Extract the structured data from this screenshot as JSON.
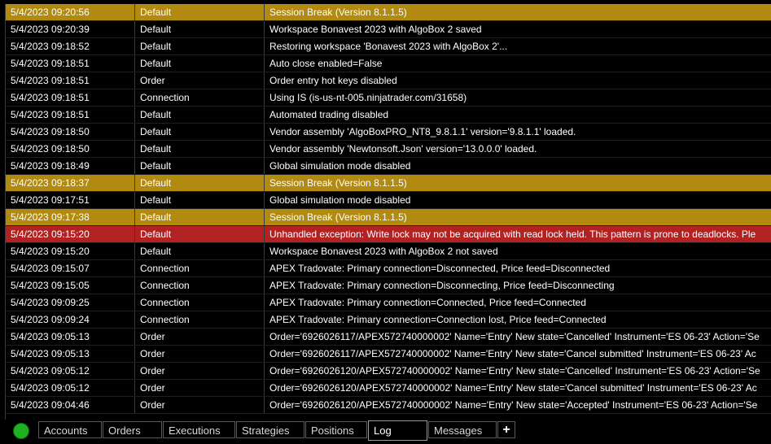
{
  "log": {
    "rows": [
      {
        "time": "5/4/2023 09:20:56",
        "category": "Default",
        "message": "Session Break (Version 8.1.1.5)",
        "kind": "session-break"
      },
      {
        "time": "5/4/2023 09:20:39",
        "category": "Default",
        "message": "Workspace Bonavest 2023 with AlgoBox 2 saved",
        "kind": "normal"
      },
      {
        "time": "5/4/2023 09:18:52",
        "category": "Default",
        "message": "Restoring workspace 'Bonavest 2023 with AlgoBox 2'...",
        "kind": "normal"
      },
      {
        "time": "5/4/2023 09:18:51",
        "category": "Default",
        "message": "Auto close enabled=False",
        "kind": "normal"
      },
      {
        "time": "5/4/2023 09:18:51",
        "category": "Order",
        "message": "Order entry hot keys disabled",
        "kind": "normal"
      },
      {
        "time": "5/4/2023 09:18:51",
        "category": "Connection",
        "message": "Using IS (is-us-nt-005.ninjatrader.com/31658)",
        "kind": "normal"
      },
      {
        "time": "5/4/2023 09:18:51",
        "category": "Default",
        "message": "Automated trading disabled",
        "kind": "normal"
      },
      {
        "time": "5/4/2023 09:18:50",
        "category": "Default",
        "message": "Vendor assembly 'AlgoBoxPRO_NT8_9.8.1.1' version='9.8.1.1' loaded.",
        "kind": "normal"
      },
      {
        "time": "5/4/2023 09:18:50",
        "category": "Default",
        "message": "Vendor assembly 'Newtonsoft.Json' version='13.0.0.0' loaded.",
        "kind": "normal"
      },
      {
        "time": "5/4/2023 09:18:49",
        "category": "Default",
        "message": "Global simulation mode disabled",
        "kind": "normal"
      },
      {
        "time": "5/4/2023 09:18:37",
        "category": "Default",
        "message": "Session Break (Version 8.1.1.5)",
        "kind": "session-break"
      },
      {
        "time": "5/4/2023 09:17:51",
        "category": "Default",
        "message": "Global simulation mode disabled",
        "kind": "normal"
      },
      {
        "time": "5/4/2023 09:17:38",
        "category": "Default",
        "message": "Session Break (Version 8.1.1.5)",
        "kind": "session-break"
      },
      {
        "time": "5/4/2023 09:15:20",
        "category": "Default",
        "message": "Unhandled exception: Write lock may not be acquired with read lock held. This pattern is prone to deadlocks. Ple",
        "kind": "error"
      },
      {
        "time": "5/4/2023 09:15:20",
        "category": "Default",
        "message": "Workspace Bonavest 2023 with AlgoBox 2 not saved",
        "kind": "normal"
      },
      {
        "time": "5/4/2023 09:15:07",
        "category": "Connection",
        "message": "APEX Tradovate: Primary connection=Disconnected, Price feed=Disconnected",
        "kind": "normal"
      },
      {
        "time": "5/4/2023 09:15:05",
        "category": "Connection",
        "message": "APEX Tradovate: Primary connection=Disconnecting, Price feed=Disconnecting",
        "kind": "normal"
      },
      {
        "time": "5/4/2023 09:09:25",
        "category": "Connection",
        "message": "APEX Tradovate: Primary connection=Connected, Price feed=Connected",
        "kind": "normal"
      },
      {
        "time": "5/4/2023 09:09:24",
        "category": "Connection",
        "message": "APEX Tradovate: Primary connection=Connection lost, Price feed=Connected",
        "kind": "normal"
      },
      {
        "time": "5/4/2023 09:05:13",
        "category": "Order",
        "message": "Order='6926026117/APEX572740000002' Name='Entry' New state='Cancelled' Instrument='ES 06-23' Action='Se",
        "kind": "normal"
      },
      {
        "time": "5/4/2023 09:05:13",
        "category": "Order",
        "message": "Order='6926026117/APEX572740000002' Name='Entry' New state='Cancel submitted' Instrument='ES 06-23' Ac",
        "kind": "normal"
      },
      {
        "time": "5/4/2023 09:05:12",
        "category": "Order",
        "message": "Order='6926026120/APEX572740000002' Name='Entry' New state='Cancelled' Instrument='ES 06-23' Action='Se",
        "kind": "normal"
      },
      {
        "time": "5/4/2023 09:05:12",
        "category": "Order",
        "message": "Order='6926026120/APEX572740000002' Name='Entry' New state='Cancel submitted' Instrument='ES 06-23' Ac",
        "kind": "normal"
      },
      {
        "time": "5/4/2023 09:04:46",
        "category": "Order",
        "message": "Order='6926026120/APEX572740000002' Name='Entry' New state='Accepted' Instrument='ES 06-23' Action='Se",
        "kind": "normal"
      }
    ]
  },
  "tabs": [
    {
      "label": "Accounts",
      "active": false
    },
    {
      "label": "Orders",
      "active": false
    },
    {
      "label": "Executions",
      "active": false
    },
    {
      "label": "Strategies",
      "active": false
    },
    {
      "label": "Positions",
      "active": false
    },
    {
      "label": "Log",
      "active": true
    },
    {
      "label": "Messages",
      "active": false
    }
  ],
  "add_tab_label": "+",
  "colors": {
    "session_break": "#b38a10",
    "error": "#b22222",
    "status_connected": "#1fb11f"
  },
  "status_icon": "connection-status-icon"
}
